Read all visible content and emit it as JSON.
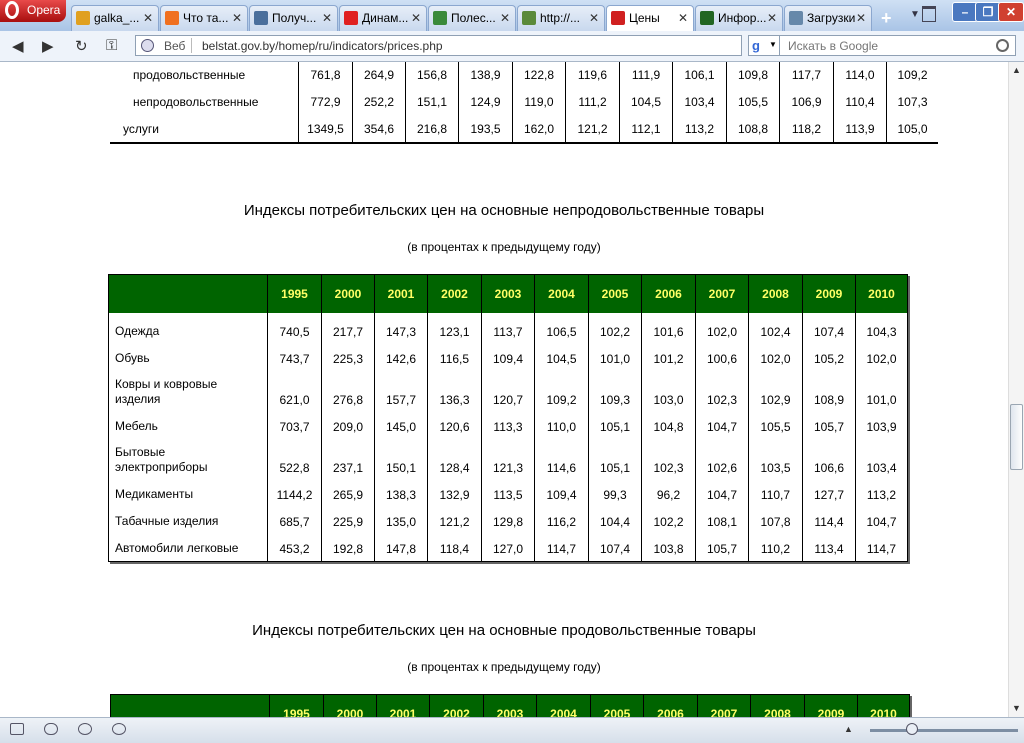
{
  "browser": {
    "menu_label": "Opera",
    "tabs": [
      {
        "title": "galka_...",
        "favicon": "circle-globe-icon",
        "color": "#e0a020"
      },
      {
        "title": "Что та...",
        "favicon": "dots-icon",
        "color": "#f07020"
      },
      {
        "title": "Получ...",
        "favicon": "vk-icon",
        "color": "#4a6f9c"
      },
      {
        "title": "Динам...",
        "favicon": "yandex-icon",
        "color": "#e02020"
      },
      {
        "title": "Полес...",
        "favicon": "leaf-icon",
        "color": "#3a8a3a"
      },
      {
        "title": "http://...",
        "favicon": "globe-icon",
        "color": "#5a8a3a"
      },
      {
        "title": "Цены",
        "favicon": "belstat-icon",
        "color": "#d02020"
      },
      {
        "title": "Инфор...",
        "favicon": "chart-icon",
        "color": "#226622"
      },
      {
        "title": "Загрузки",
        "favicon": "downloads-icon",
        "color": "#6688aa"
      }
    ],
    "address": {
      "prefix": "Веб",
      "url": "belstat.gov.by/homep/ru/indicators/prices.php"
    },
    "search": {
      "placeholder": "Искать в Google",
      "engine": "g"
    }
  },
  "top_table": {
    "rows": [
      {
        "label": "продовольственные",
        "values": [
          "761,8",
          "264,9",
          "156,8",
          "138,9",
          "122,8",
          "119,6",
          "111,9",
          "106,1",
          "109,8",
          "117,7",
          "114,0",
          "109,2"
        ]
      },
      {
        "label": "непродовольственные",
        "values": [
          "772,9",
          "252,2",
          "151,1",
          "124,9",
          "119,0",
          "111,2",
          "104,5",
          "103,4",
          "105,5",
          "106,9",
          "110,4",
          "107,3"
        ]
      },
      {
        "label": "услуги",
        "values": [
          "1349,5",
          "354,6",
          "216,8",
          "193,5",
          "162,0",
          "121,2",
          "112,1",
          "113,2",
          "108,8",
          "118,2",
          "113,9",
          "105,0"
        ]
      }
    ]
  },
  "nonfood": {
    "title": "Индексы потребительских цен на основные непродовольственные товары",
    "subtitle": "(в процентах к предыдущему году)",
    "years": [
      "1995",
      "2000",
      "2001",
      "2002",
      "2003",
      "2004",
      "2005",
      "2006",
      "2007",
      "2008",
      "2009",
      "2010"
    ],
    "rows": [
      {
        "label": "Одежда",
        "values": [
          "740,5",
          "217,7",
          "147,3",
          "123,1",
          "113,7",
          "106,5",
          "102,2",
          "101,6",
          "102,0",
          "102,4",
          "107,4",
          "104,3"
        ]
      },
      {
        "label": "Обувь",
        "values": [
          "743,7",
          "225,3",
          "142,6",
          "116,5",
          "109,4",
          "104,5",
          "101,0",
          "101,2",
          "100,6",
          "102,0",
          "105,2",
          "102,0"
        ]
      },
      {
        "label": "Ковры и ковровые изделия",
        "values": [
          "621,0",
          "276,8",
          "157,7",
          "136,3",
          "120,7",
          "109,2",
          "109,3",
          "103,0",
          "102,3",
          "102,9",
          "108,9",
          "101,0"
        ]
      },
      {
        "label": "Мебель",
        "values": [
          "703,7",
          "209,0",
          "145,0",
          "120,6",
          "113,3",
          "110,0",
          "105,1",
          "104,8",
          "104,7",
          "105,5",
          "105,7",
          "103,9"
        ]
      },
      {
        "label": "Бытовые электроприборы",
        "values": [
          "522,8",
          "237,1",
          "150,1",
          "128,4",
          "121,3",
          "114,6",
          "105,1",
          "102,3",
          "102,6",
          "103,5",
          "106,6",
          "103,4"
        ]
      },
      {
        "label": "Медикаменты",
        "values": [
          "1144,2",
          "265,9",
          "138,3",
          "132,9",
          "113,5",
          "109,4",
          "99,3",
          "96,2",
          "104,7",
          "110,7",
          "127,7",
          "113,2"
        ]
      },
      {
        "label": "Табачные изделия",
        "values": [
          "685,7",
          "225,9",
          "135,0",
          "121,2",
          "129,8",
          "116,2",
          "104,4",
          "102,2",
          "108,1",
          "107,8",
          "114,4",
          "104,7"
        ]
      },
      {
        "label": "Автомобили легковые",
        "values": [
          "453,2",
          "192,8",
          "147,8",
          "118,4",
          "127,0",
          "114,7",
          "107,4",
          "103,8",
          "105,7",
          "110,2",
          "113,4",
          "114,7"
        ]
      }
    ]
  },
  "food": {
    "title": "Индексы потребительских цен на основные продовольственные товары",
    "subtitle": "(в процентах к предыдущему году)",
    "years": [
      "1995",
      "2000",
      "2001",
      "2002",
      "2003",
      "2004",
      "2005",
      "2006",
      "2007",
      "2008",
      "2009",
      "2010"
    ]
  },
  "colors": {
    "header_bg": "#006400",
    "header_text": "#ffff66"
  }
}
